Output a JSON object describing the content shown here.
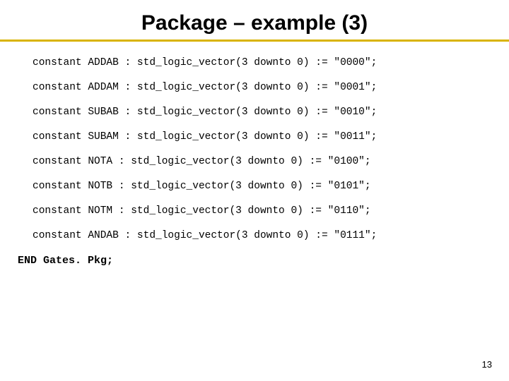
{
  "title": "Package – example (3)",
  "constants": [
    {
      "name": "ADDAB",
      "type": "std_logic_vector(3 downto 0)",
      "value": "\"0000\""
    },
    {
      "name": "ADDAM",
      "type": "std_logic_vector(3 downto 0)",
      "value": "\"0001\""
    },
    {
      "name": "SUBAB",
      "type": "std_logic_vector(3 downto 0)",
      "value": "\"0010\""
    },
    {
      "name": "SUBAM",
      "type": "std_logic_vector(3 downto 0)",
      "value": "\"0011\""
    },
    {
      "name": "NOTA",
      "type": "std_logic_vector(3 downto 0)",
      "value": "\"0100\""
    },
    {
      "name": "NOTB",
      "type": "std_logic_vector(3 downto 0)",
      "value": "\"0101\""
    },
    {
      "name": "NOTM",
      "type": "std_logic_vector(3 downto 0)",
      "value": "\"0110\""
    },
    {
      "name": "ANDAB",
      "type": "std_logic_vector(3 downto 0)",
      "value": "\"0111\""
    }
  ],
  "endLine": "END Gates. Pkg;",
  "pageNumber": "13",
  "lines": {
    "l0": "constant ADDAB : std_logic_vector(3 downto 0) := \"0000\";",
    "l1": "constant ADDAM : std_logic_vector(3 downto 0) := \"0001\";",
    "l2": "constant SUBAB : std_logic_vector(3 downto 0) := \"0010\";",
    "l3": "constant SUBAM : std_logic_vector(3 downto 0) := \"0011\";",
    "l4": "constant NOTA : std_logic_vector(3 downto 0) := \"0100\";",
    "l5": "constant NOTB : std_logic_vector(3 downto 0) := \"0101\";",
    "l6": "constant NOTM : std_logic_vector(3 downto 0) := \"0110\";",
    "l7": "constant ANDAB : std_logic_vector(3 downto 0) := \"0111\";"
  }
}
